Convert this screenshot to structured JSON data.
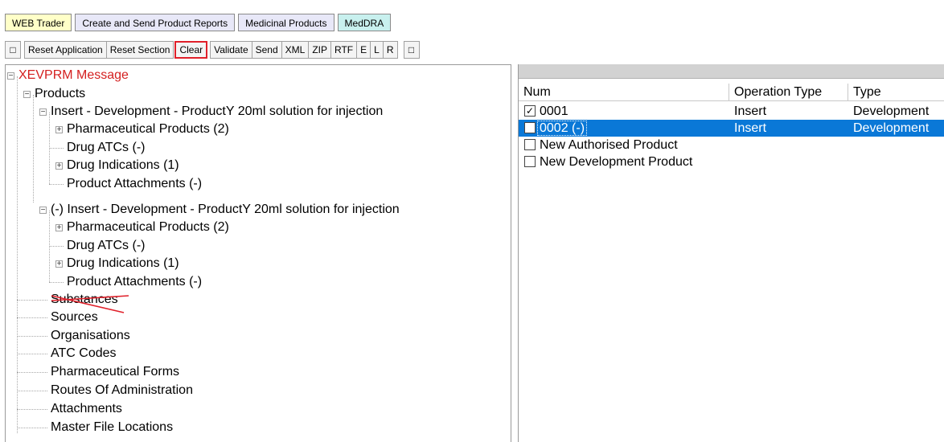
{
  "tabs": {
    "web_trader": "WEB Trader",
    "reports": "Create and Send Product Reports",
    "medicinal": "Medicinal Products",
    "meddra": "MedDRA"
  },
  "toolbar": {
    "toggle_left": "□",
    "reset_application": "Reset Application",
    "reset_section": "Reset Section",
    "clear": "Clear",
    "validate": "Validate",
    "send": "Send",
    "xml": "XML",
    "zip": "ZIP",
    "rtf": "RTF",
    "e": "E",
    "l": "L",
    "r": "R",
    "toggle_right": "□"
  },
  "tree": {
    "root": "XEVPRM Message",
    "products": "Products",
    "product1": "Insert - Development - ProductY 20ml solution for injection",
    "p1_pharma": "Pharmaceutical Products (2)",
    "p1_atc": "Drug ATCs (-)",
    "p1_ind": "Drug Indications (1)",
    "p1_att": "Product Attachments (-)",
    "product2": "(-) Insert - Development - ProductY 20ml solution for injection",
    "p2_pharma": "Pharmaceutical Products (2)",
    "p2_atc": "Drug ATCs (-)",
    "p2_ind": "Drug Indications (1)",
    "p2_att": "Product Attachments (-)",
    "substances": "Substances",
    "sources": "Sources",
    "organisations": "Organisations",
    "atc_codes": "ATC Codes",
    "pharma_forms": "Pharmaceutical Forms",
    "routes": "Routes Of Administration",
    "attachments": "Attachments",
    "master_files": "Master File Locations"
  },
  "grid": {
    "columns": {
      "num": "Num",
      "operation": "Operation Type",
      "type": "Type"
    },
    "rows": [
      {
        "checked": "✓",
        "num": "0001",
        "operation": "Insert",
        "type": "Development"
      },
      {
        "checked": "",
        "num": "0002 (-)",
        "operation": "Insert",
        "type": "Development"
      },
      {
        "checked": "",
        "num": "New Authorised Product",
        "operation": "",
        "type": ""
      },
      {
        "checked": "",
        "num": "New Development Product",
        "operation": "",
        "type": ""
      }
    ]
  },
  "colors": {
    "selection": "#0a78d7",
    "root_red": "#d42020",
    "highlight_red": "#e0202a"
  }
}
